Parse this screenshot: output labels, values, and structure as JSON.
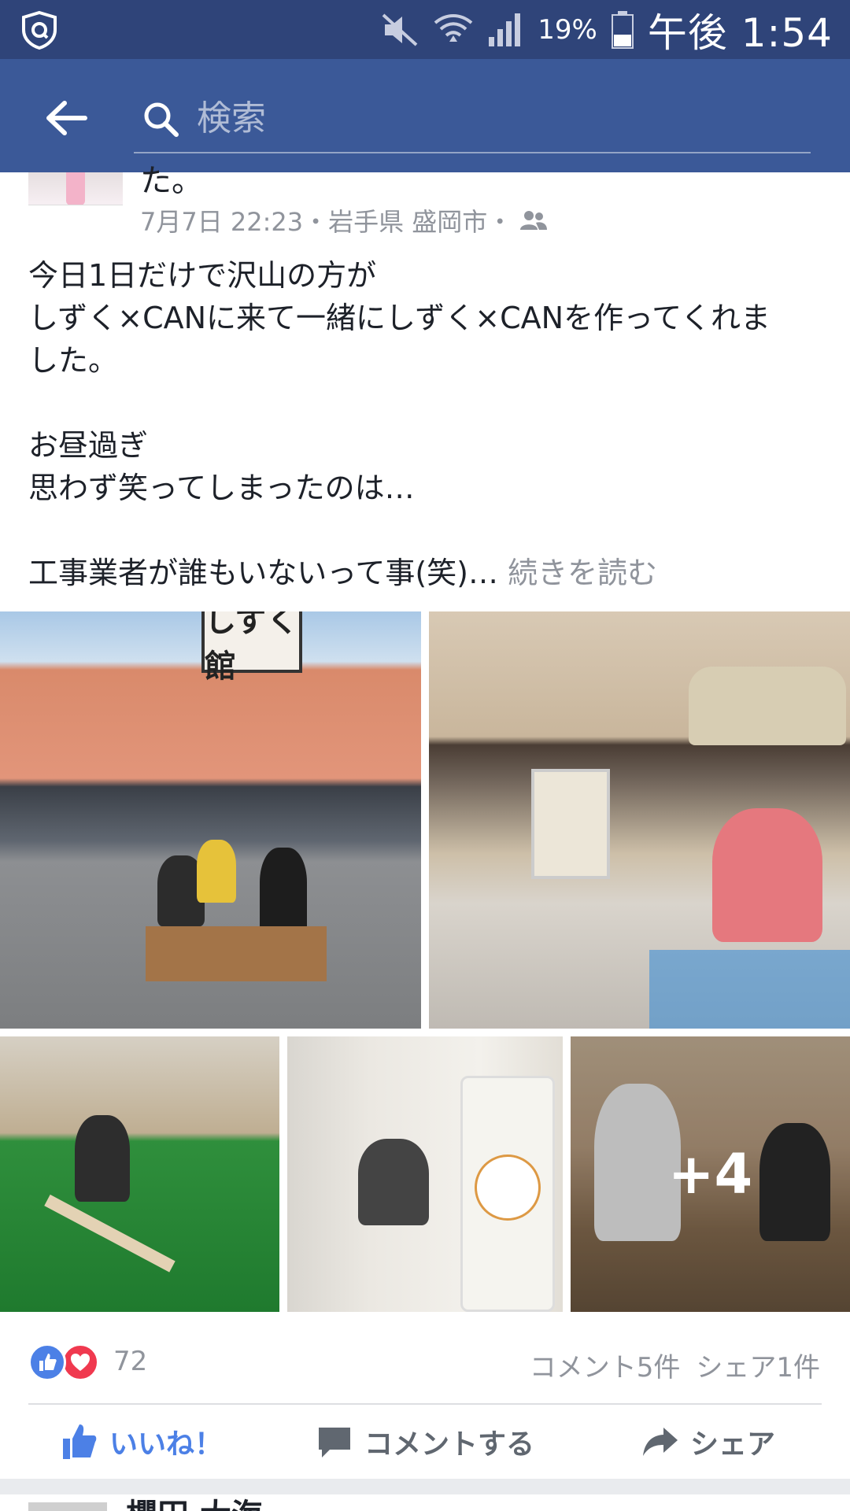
{
  "status_bar": {
    "battery_percent": "19%",
    "time": "午後 1:54"
  },
  "search": {
    "placeholder": "検索"
  },
  "post": {
    "name_tail": "た。",
    "meta_text": "7月7日 22:23・岩手県 盛岡市・",
    "body_lines": [
      "今日1日だけで沢山の方が",
      "しずく×CANに来て一緒にしずく×CANを作ってくれま",
      "した。",
      "",
      "お昼過ぎ",
      "思わず笑ってしまったのは…",
      "",
      "工事業者が誰もいないって事(笑)…"
    ],
    "see_more": "続きを読む",
    "photo_sign_text": "しずく館",
    "more_photos_count": "+4",
    "reaction_count": "72",
    "comments_count": "コメント5件",
    "shares_count": "シェア1件"
  },
  "actions": {
    "like_label": "いいね！",
    "comment_label": "コメントする",
    "share_label": "シェア"
  },
  "next_post": {
    "name": "櫻田 大海"
  },
  "colors": {
    "status_bar": "#2f4479",
    "header": "#3b5998",
    "like_blue": "#4c80e6",
    "love_red": "#f0394f"
  }
}
